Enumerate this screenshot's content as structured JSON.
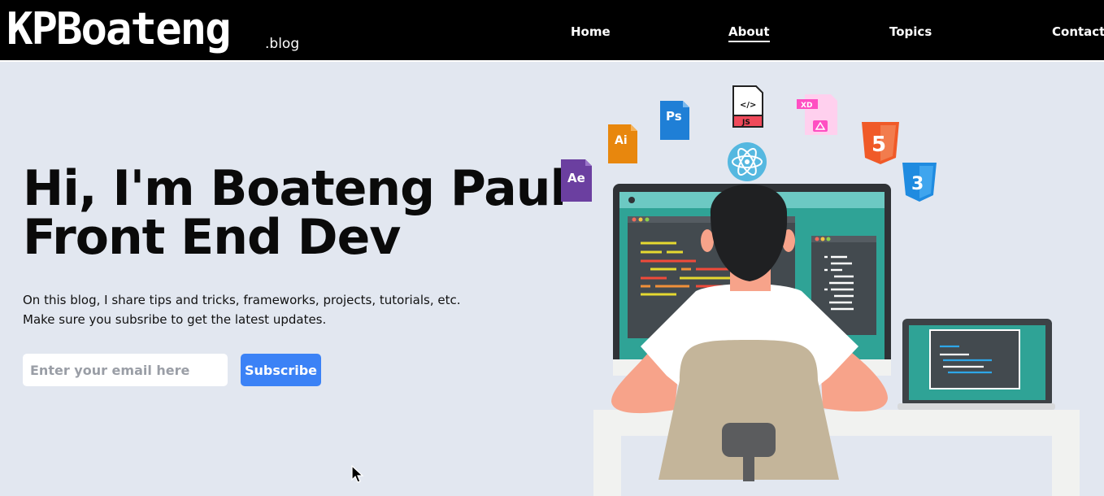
{
  "header": {
    "logo": "KPBoateng",
    "logo_suffix": ".blog",
    "nav": [
      {
        "label": "Home",
        "active": false
      },
      {
        "label": "About",
        "active": true
      },
      {
        "label": "Topics",
        "active": false
      },
      {
        "label": "Contact",
        "active": false
      }
    ]
  },
  "hero": {
    "title_line1": "Hi, I'm Boateng Paul",
    "title_line2": "Front End Dev",
    "text_line1": "On this blog, I share tips and tricks, frameworks, projects, tutorials, etc.",
    "text_line2": "Make sure you subsribe to get the latest updates.",
    "email_placeholder": "Enter your email here",
    "subscribe_label": "Subscribe"
  },
  "illustration": {
    "icons": [
      {
        "name": "after-effects-icon",
        "label": "Ae",
        "color": "#6b3fa0"
      },
      {
        "name": "illustrator-icon",
        "label": "Ai",
        "color": "#e8870d"
      },
      {
        "name": "photoshop-icon",
        "label": "Ps",
        "color": "#1f7fd6"
      },
      {
        "name": "javascript-file-icon",
        "label": "JS",
        "color": "#f04a5b"
      },
      {
        "name": "adobe-xd-icon",
        "label": "XD",
        "color": "#ff4fc2"
      },
      {
        "name": "html5-icon",
        "label": "5",
        "color": "#f05a28"
      },
      {
        "name": "css3-icon",
        "label": "3",
        "color": "#1f8be0"
      },
      {
        "name": "react-icon",
        "label": "",
        "color": "#55b8e0"
      }
    ]
  },
  "colors": {
    "background": "#e2e7f0",
    "header": "#000000",
    "accent": "#3b82f6"
  }
}
